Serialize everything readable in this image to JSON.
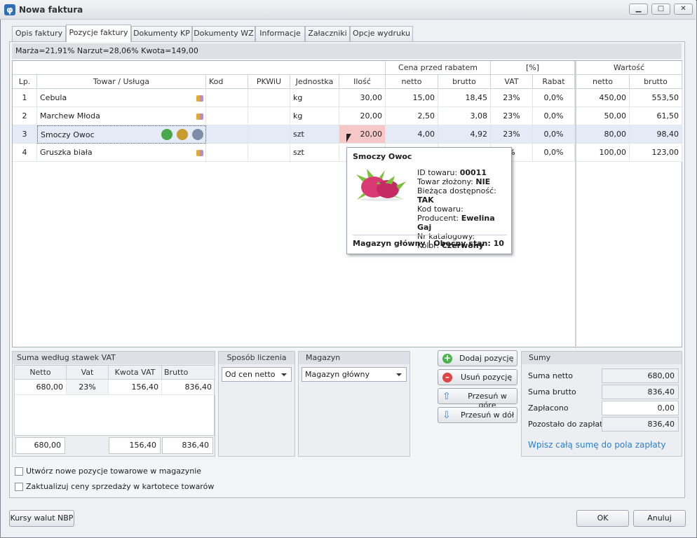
{
  "window": {
    "title": "Nowa faktura"
  },
  "tabs": [
    "Opis faktury",
    "Pozycje faktury",
    "Dokumenty KP",
    "Dokumenty WZ",
    "Informacje",
    "Załaczniki",
    "Opcje wydruku"
  ],
  "summary_bar": "Marża=21,91%  Narzut=28,06%  Kwota=149,00",
  "grid": {
    "group_headers": {
      "price": "Cena przed rabatem",
      "percent": "[%]",
      "value": "Wartość"
    },
    "columns": [
      "Lp.",
      "Towar / Usługa",
      "Kod",
      "PKWiU",
      "Jednostka",
      "Ilość",
      "netto",
      "brutto",
      "VAT",
      "Rabat",
      "netto",
      "brutto"
    ],
    "rows": [
      {
        "lp": "1",
        "name": "Cebula",
        "code": "",
        "pkwiu": "",
        "unit": "kg",
        "qty": "30,00",
        "netto": "15,00",
        "brutto": "18,45",
        "vat": "23%",
        "rabat": "0,0%",
        "w_netto": "450,00",
        "w_brutto": "553,50"
      },
      {
        "lp": "2",
        "name": "Marchew Młoda",
        "code": "",
        "pkwiu": "",
        "unit": "kg",
        "qty": "20,00",
        "netto": "2,50",
        "brutto": "3,08",
        "vat": "23%",
        "rabat": "0,0%",
        "w_netto": "50,00",
        "w_brutto": "61,50"
      },
      {
        "lp": "3",
        "name": "Smoczy Owoc",
        "code": "",
        "pkwiu": "",
        "unit": "szt",
        "qty": "20,00",
        "netto": "4,00",
        "brutto": "4,92",
        "vat": "23%",
        "rabat": "0,0%",
        "w_netto": "80,00",
        "w_brutto": "98,40"
      },
      {
        "lp": "4",
        "name": "Gruszka biała",
        "code": "",
        "pkwiu": "",
        "unit": "szt",
        "qty": "",
        "netto": "",
        "brutto": "",
        "vat": "%",
        "rabat": "0,0%",
        "w_netto": "100,00",
        "w_brutto": "123,00"
      }
    ]
  },
  "tooltip": {
    "title": "Smoczy Owoc",
    "lines": [
      {
        "label": "ID towaru: ",
        "value": "00011"
      },
      {
        "label": "Towar złożony: ",
        "value": "NIE"
      },
      {
        "label": "Bieżąca dostępność: ",
        "value": "TAK"
      },
      {
        "label": "Kod towaru: ",
        "value": ""
      },
      {
        "label": "Producent: ",
        "value": "Ewelina Gaj"
      },
      {
        "label": "Nr katalogowy: ",
        "value": ""
      },
      {
        "label": "Kolor: ",
        "value": "Czerwony"
      }
    ],
    "footer": "Magazyn główny | Obecny stan: 10"
  },
  "vat_summary": {
    "title": "Suma według stawek VAT",
    "headers": [
      "Netto",
      "Vat",
      "Kwota VAT",
      "Brutto"
    ],
    "rows": [
      [
        "680,00",
        "23%",
        "156,40",
        "836,40"
      ]
    ],
    "totals": {
      "netto": "680,00",
      "kwota_vat": "156,40",
      "brutto": "836,40"
    }
  },
  "calc_method": {
    "title": "Sposób liczenia",
    "value": "Od cen netto"
  },
  "warehouse": {
    "title": "Magazyn",
    "value": "Magazyn główny"
  },
  "actions": {
    "add": "Dodaj pozycję",
    "remove": "Usuń pozycję",
    "up": "Przesuń w górę",
    "down": "Przesuń w dół"
  },
  "sums": {
    "title": "Sumy",
    "netto_label": "Suma netto",
    "netto": "680,00",
    "brutto_label": "Suma brutto",
    "brutto": "836,40",
    "paid_label": "Zapłacono",
    "paid": "0,00",
    "left_label": "Pozostało do zapłaty",
    "left": "836,40",
    "link": "Wpisz całą sumę do pola zapłaty"
  },
  "checkboxes": {
    "create_items": "Utwórz nowe pozycje towarowe w magazynie",
    "update_prices": "Zaktualizuj ceny sprzedaży w kartotece towarów"
  },
  "footer": {
    "nbp": "Kursy walut NBP",
    "ok": "OK",
    "cancel": "Anuluj"
  },
  "colors": {
    "selected_row": "#e4ebf7",
    "qty_highlight": "#f6c7c7",
    "link": "#2a7fd4",
    "tooltip_fruit": "#d93a74"
  }
}
